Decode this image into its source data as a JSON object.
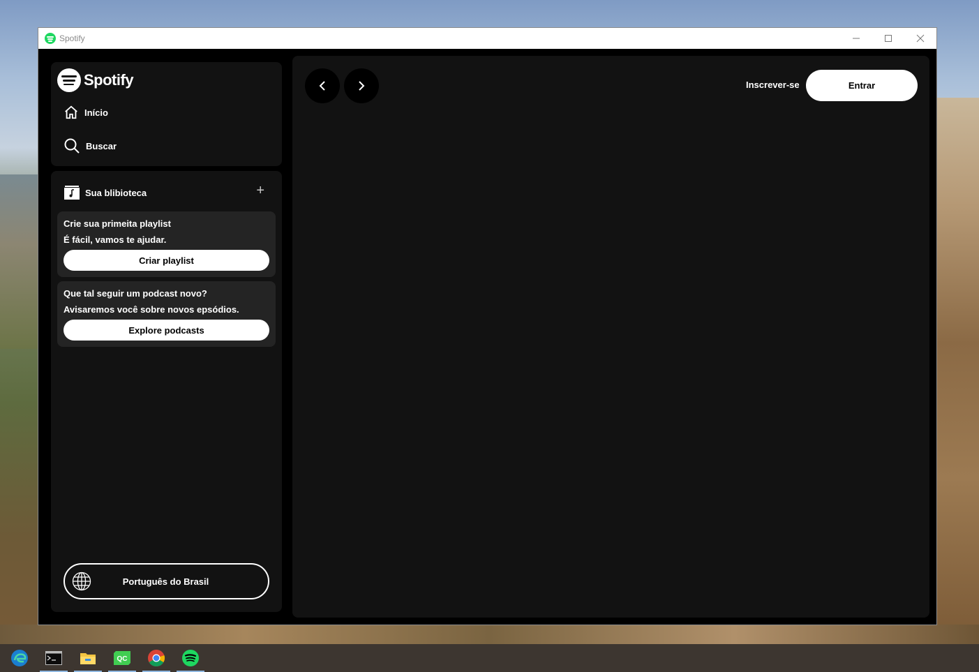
{
  "window": {
    "title": "Spotify",
    "controls": [
      "minimize-icon",
      "maximize-icon",
      "close-icon"
    ]
  },
  "brand": {
    "name": "Spotify"
  },
  "nav": {
    "home": "Início",
    "search": "Buscar"
  },
  "library": {
    "title": "Sua blibioteca",
    "cards": [
      {
        "title": "Crie sua primeita playlist",
        "subtitle": "É fácil, vamos te ajudar.",
        "button": "Criar playlist"
      },
      {
        "title": "Que tal seguir um podcast novo?",
        "subtitle": "Avisaremos você sobre novos epsódios.",
        "button": "Explore podcasts"
      }
    ],
    "language_button": "Português do Brasil"
  },
  "header": {
    "back_glyph": "<",
    "forward_glyph": ">",
    "signup": "Inscrever-se",
    "login": "Entrar"
  },
  "taskbar": {
    "apps": [
      "edge-icon",
      "terminal-icon",
      "file-explorer-icon",
      "qt-creator-icon",
      "chrome-icon",
      "spotify-icon"
    ]
  },
  "colors": {
    "accent": "#1ed760",
    "panel": "#121212",
    "card": "#242424"
  }
}
